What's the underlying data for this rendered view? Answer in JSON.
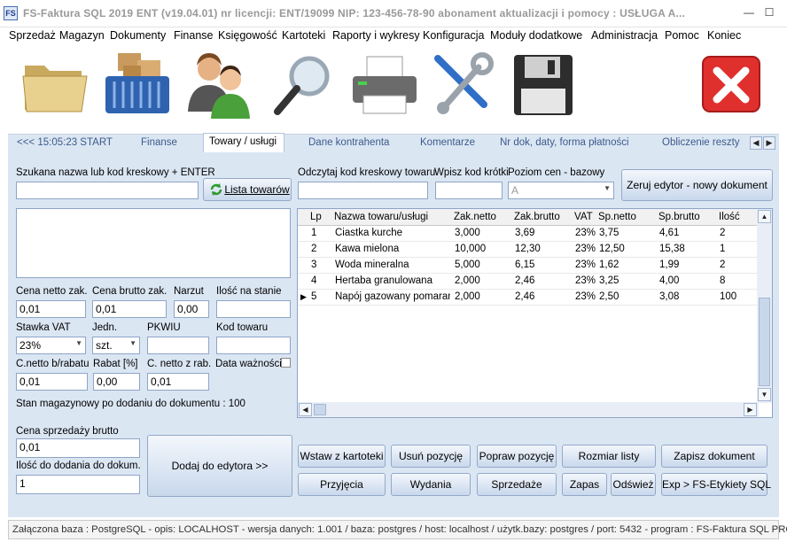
{
  "window": {
    "title": "FS-Faktura SQL 2019 ENT (v19.04.01)      nr licencji: ENT/19099      NIP: 123-456-78-90      abonament aktualizacji i pomocy : USŁUGA A...",
    "app_icon": "FS"
  },
  "menu": [
    "Sprzedaż",
    "Magazyn",
    "Dokumenty",
    "Finanse",
    "Księgowość",
    "Kartoteki",
    "Raporty i wykresy",
    "Konfiguracja",
    "Moduły dodatkowe",
    "Administracja",
    "Pomoc",
    "Koniec"
  ],
  "toolbar": [
    "folder-icon",
    "warehouse-basket-icon",
    "users-icon",
    "magnifier-icon",
    "printer-icon",
    "tools-icon",
    "floppy-disk-icon",
    "close-red-icon"
  ],
  "tabs": {
    "items": [
      "<<<  15:05:23  START",
      "Finanse",
      "Towary  / usługi",
      "Dane kontrahenta",
      "Komentarze",
      "Nr dok, daty, forma płatności",
      "Obliczenie reszty"
    ],
    "active_index": 2
  },
  "search": {
    "label": "Szukana nazwa lub kod kreskowy + ENTER",
    "value": "",
    "list_button": "Lista towarów"
  },
  "barcode": {
    "label": "Odczytaj kod kreskowy towaru",
    "value": ""
  },
  "shortcode": {
    "label": "Wpisz kod krótki",
    "value": ""
  },
  "price_level": {
    "label": "Poziom cen - bazowy",
    "value": "A"
  },
  "reset_button": "Zeruj edytor - nowy dokument",
  "fields": {
    "cena_netto_zak": {
      "label": "Cena netto zak.",
      "value": "0,01"
    },
    "cena_brutto_zak": {
      "label": "Cena brutto zak.",
      "value": "0,01"
    },
    "narzut": {
      "label": "Narzut",
      "value": "0,00"
    },
    "ilosc_na_stanie": {
      "label": "Ilość na stanie",
      "value": ""
    },
    "stawka_vat": {
      "label": "Stawka VAT",
      "value": "23%"
    },
    "jedn": {
      "label": "Jedn.",
      "value": "szt."
    },
    "pkwiu": {
      "label": "PKWIU",
      "value": ""
    },
    "kod_towaru": {
      "label": "Kod towaru",
      "value": ""
    },
    "cnetto_brabatu": {
      "label": "C.netto b/rabatu",
      "value": "0,01"
    },
    "rabat": {
      "label": "Rabat [%]",
      "value": "0,00"
    },
    "cnetto_zrab": {
      "label": "C. netto z rab.",
      "value": "0,01"
    },
    "data_waznosci": {
      "label": "Data ważności"
    }
  },
  "stock_text": "Stan magazynowy po dodaniu do dokumentu : 100",
  "sale_price": {
    "label": "Cena sprzedaży brutto",
    "value": "0,01"
  },
  "qty_to_add": {
    "label": "Ilość do dodania do dokum.",
    "value": "1"
  },
  "add_button": "Dodaj do edytora      >>",
  "grid": {
    "columns": [
      "Lp",
      "Nazwa towaru/usługi",
      "Zak.netto",
      "Zak.brutto",
      "VAT",
      "Sp.netto",
      "Sp.brutto",
      "Ilość"
    ],
    "rows": [
      [
        "1",
        "Ciastka kurche",
        "3,000",
        "3,69",
        "23%",
        "3,75",
        "4,61",
        "2"
      ],
      [
        "2",
        "Kawa mielona",
        "10,000",
        "12,30",
        "23%",
        "12,50",
        "15,38",
        "1"
      ],
      [
        "3",
        "Woda mineralna",
        "5,000",
        "6,15",
        "23%",
        "1,62",
        "1,99",
        "2"
      ],
      [
        "4",
        "Hertaba granulowana",
        "2,000",
        "2,46",
        "23%",
        "3,25",
        "4,00",
        "8"
      ],
      [
        "5",
        "Napój gazowany pomarańc",
        "2,000",
        "2,46",
        "23%",
        "2,50",
        "3,08",
        "100"
      ]
    ],
    "current_row_index": 4
  },
  "buttons_row1": [
    "Wstaw z kartoteki",
    "Usuń pozycję",
    "Popraw pozycję",
    "Rozmiar listy",
    "Zapisz dokument"
  ],
  "buttons_row2": [
    "Przyjęcia",
    "Wydania",
    "Sprzedaże",
    "Zapas",
    "Odśwież",
    "Exp > FS-Etykiety SQL"
  ],
  "status_text": "Załączona baza : PostgreSQL - opis: LOCALHOST - wersja danych: 1.001  / baza: postgres / host: localhost / użytk.bazy: postgres /  port: 5432  -  program :  FS-Faktura SQL PRO",
  "colors": {
    "panel": "#dbe6f3",
    "accent": "#3c5a8a"
  }
}
